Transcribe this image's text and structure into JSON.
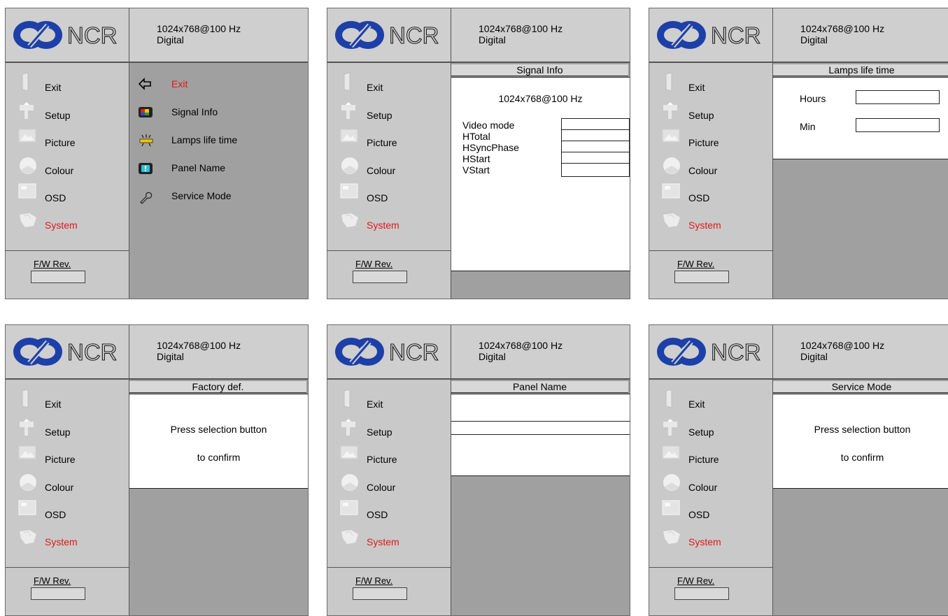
{
  "shared": {
    "brand": "NCR",
    "resolution": "1024x768@100 Hz",
    "input": "Digital",
    "sidebar": [
      {
        "label": "Exit",
        "icon": "door-icon"
      },
      {
        "label": "Setup",
        "icon": "tools-icon"
      },
      {
        "label": "Picture",
        "icon": "picture-icon"
      },
      {
        "label": "Colour",
        "icon": "colour-disc-icon"
      },
      {
        "label": "OSD",
        "icon": "osd-window-icon"
      },
      {
        "label": "System",
        "icon": "system-hand-icon"
      }
    ],
    "fw_label": "F/W Rev.",
    "colors": {
      "active": "#e01818",
      "logo_blue": "#1d3fa8",
      "panel_bg": "#a0a0a0",
      "sidebar_bg": "#c9c9c9",
      "header_bg": "#cfcfcf"
    }
  },
  "panels": [
    {
      "submenu": [
        {
          "label": "Exit",
          "icon": "back-arrow-icon",
          "active": true
        },
        {
          "label": "Signal Info",
          "icon": "signal-info-icon"
        },
        {
          "label": "Lamps life time",
          "icon": "lamp-icon"
        },
        {
          "label": "Panel Name",
          "icon": "panel-name-icon"
        },
        {
          "label": "Service Mode",
          "icon": "wrench-icon"
        }
      ]
    },
    {
      "title": "Signal Info",
      "resolution": "1024x768@100 Hz",
      "fields": [
        "Video mode",
        "HTotal",
        "HSyncPhase",
        "HStart",
        "VStart"
      ]
    },
    {
      "title": "Lamps life time",
      "fields": [
        "Hours",
        "Min"
      ]
    },
    {
      "title": "Factory def.",
      "line1": "Press selection button",
      "line2": "to confirm"
    },
    {
      "title": "Panel Name"
    },
    {
      "title": "Service Mode",
      "line1": "Press selection button",
      "line2": "to confirm"
    }
  ]
}
